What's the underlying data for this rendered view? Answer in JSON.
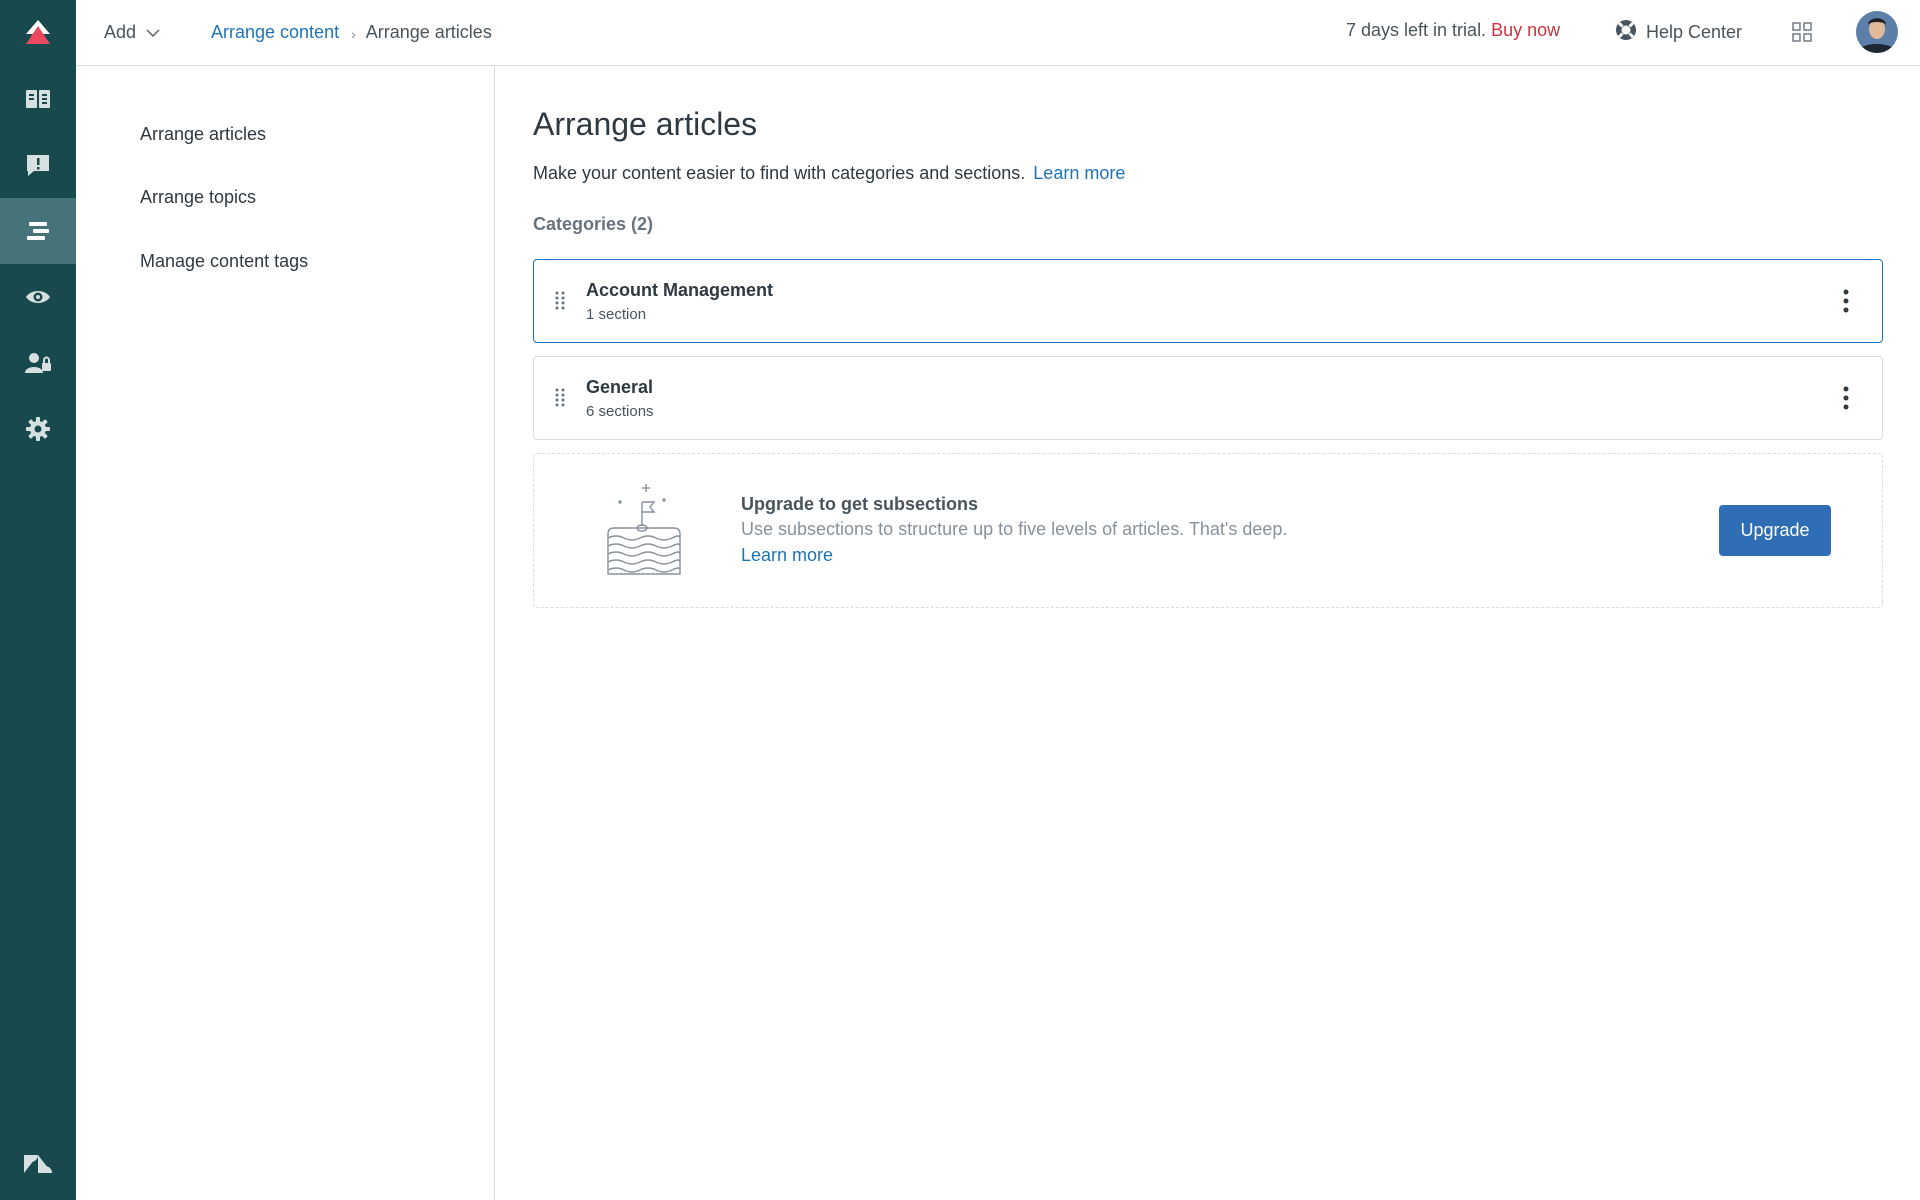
{
  "colors": {
    "rail": "#17494d",
    "rail_active": "#467279",
    "link": "#1f73b7",
    "buy_now": "#cc3340",
    "primary_button": "#2f6db5",
    "selected_border": "#1f73b7"
  },
  "rail": {
    "items": [
      {
        "icon": "guide-book-icon"
      },
      {
        "icon": "alert-comment-icon"
      },
      {
        "icon": "arrange-content-icon",
        "active": true
      },
      {
        "icon": "eye-icon"
      },
      {
        "icon": "user-lock-icon"
      },
      {
        "icon": "gear-icon"
      }
    ],
    "logo_icon": "zendesk-arrow-icon",
    "brand_icon": "zendesk-z-icon"
  },
  "header": {
    "add_label": "Add",
    "breadcrumb": {
      "parent": "Arrange content",
      "current": "Arrange articles"
    },
    "trial_text": "7 days left in trial.",
    "buy_now": "Buy now",
    "help_center": "Help Center"
  },
  "subnav": {
    "items": [
      {
        "label": "Arrange articles"
      },
      {
        "label": "Arrange topics"
      },
      {
        "label": "Manage content tags"
      }
    ]
  },
  "main": {
    "title": "Arrange articles",
    "intro": "Make your content easier to find with categories and sections.",
    "intro_link": "Learn more",
    "categories_heading": "Categories (2)",
    "categories": [
      {
        "name": "Account Management",
        "count": "1 section",
        "selected": true
      },
      {
        "name": "General",
        "count": "6 sections",
        "selected": false
      }
    ],
    "upgrade": {
      "title": "Upgrade to get subsections",
      "description": "Use subsections to structure up to five levels of articles. That's deep.",
      "link": "Learn more",
      "button": "Upgrade"
    }
  }
}
